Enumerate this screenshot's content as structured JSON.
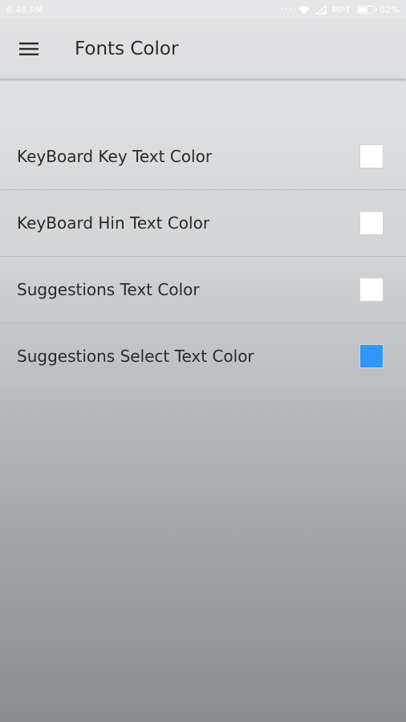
{
  "status_bar": {
    "time": "8:48 PM",
    "carrier": "MPT",
    "battery": "62%",
    "battery_level": 0.62
  },
  "app_bar": {
    "menu_icon": "hamburger-menu-icon",
    "title": "Fonts Color"
  },
  "settings": {
    "items": [
      {
        "label": "KeyBoard Key Text Color",
        "color": "#ffffff"
      },
      {
        "label": "KeyBoard Hin Text Color",
        "color": "#ffffff"
      },
      {
        "label": "Suggestions Text Color",
        "color": "#ffffff"
      },
      {
        "label": "Suggestions Select Text Color",
        "color": "#2f97f7"
      }
    ]
  }
}
